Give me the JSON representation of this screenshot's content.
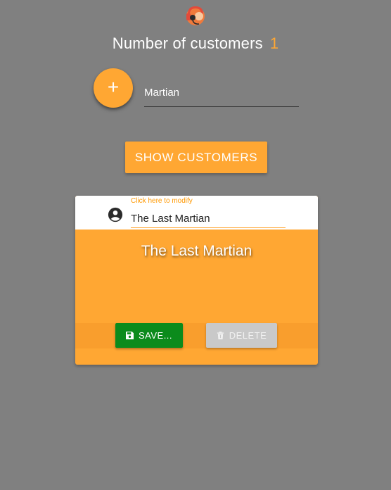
{
  "header": {
    "logo_icon": "support-agent-headset-icon",
    "title": "Number of customers",
    "count": "1"
  },
  "add_form": {
    "add_icon": "plus-icon",
    "add_symbol": "+",
    "name_value": "Martian"
  },
  "show_button_label": "SHOW CUSTOMERS",
  "customer_card": {
    "person_icon": "account-circle-icon",
    "hint": "Click here to modify",
    "name_value": "The Last Martian",
    "title": "The Last Martian",
    "save_icon": "floppy-disk-icon",
    "save_label": "SAVE...",
    "delete_icon": "trash-icon",
    "delete_label": "DELETE"
  },
  "colors": {
    "background": "#808080",
    "accent": "#ffa733",
    "save": "#0b8b1c",
    "delete_disabled": "#c9c9c9"
  }
}
